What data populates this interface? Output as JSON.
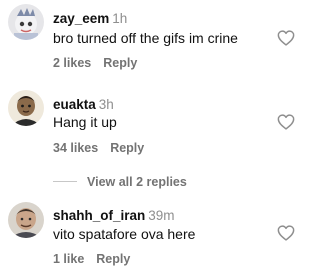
{
  "comments": [
    {
      "username": "zay_eem",
      "time": "1h",
      "text": "bro turned off the gifs im crine",
      "likes": "2 likes",
      "reply_label": "Reply"
    },
    {
      "username": "euakta",
      "time": "3h",
      "text": "Hang it up",
      "likes": "34 likes",
      "reply_label": "Reply"
    },
    {
      "username": "shahh_of_iran",
      "time": "39m",
      "text": "vito spatafore ova here",
      "likes": "1 like",
      "reply_label": "Reply"
    }
  ],
  "view_replies_label": "View all 2 replies",
  "icons": {
    "like": "heart-outline-icon"
  },
  "colors": {
    "username": "#111111",
    "secondary_text": "#737373",
    "timestamp": "#8e8e8e"
  }
}
